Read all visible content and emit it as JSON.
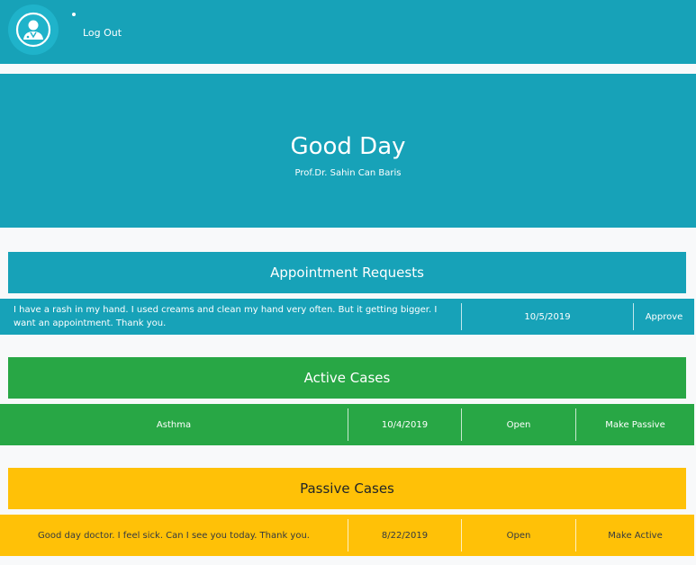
{
  "navbar": {
    "logo_icon": "doctor-avatar-icon",
    "logout_label": "Log Out"
  },
  "hero": {
    "title": "Good Day",
    "subtitle": "Prof.Dr. Sahin Can Baris"
  },
  "appointment_requests": {
    "title": "Appointment Requests",
    "rows": [
      {
        "message": "I have a rash in my hand. I used creams and clean my hand very often. But it getting bigger. I want an appointment. Thank you.",
        "date": "10/5/2019",
        "action": "Approve"
      }
    ]
  },
  "active_cases": {
    "title": "Active Cases",
    "rows": [
      {
        "description": "Asthma",
        "date": "10/4/2019",
        "open_label": "Open",
        "action": "Make Passive"
      }
    ]
  },
  "passive_cases": {
    "title": "Passive Cases",
    "rows": [
      {
        "description": "Good day doctor. I feel sick. Can I see you today. Thank you.",
        "date": "8/22/2019",
        "open_label": "Open",
        "action": "Make Active"
      }
    ]
  },
  "colors": {
    "info": "#17a2b8",
    "success": "#28a745",
    "warning": "#ffc107",
    "background": "#f8f9fa"
  }
}
